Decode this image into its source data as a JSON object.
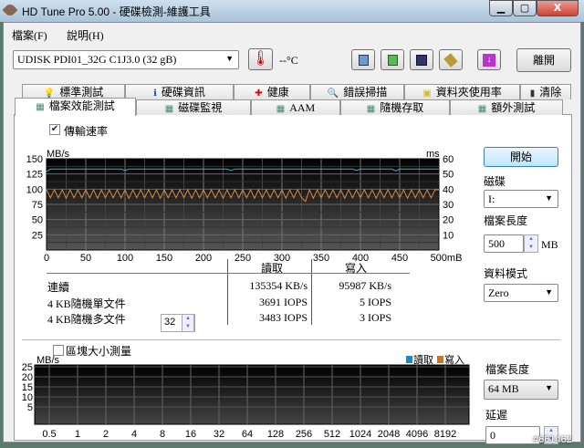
{
  "window": {
    "title": "HD Tune Pro  5.00 - 硬碟檢測-維護工具",
    "minimize": "▁",
    "maximize": "▢",
    "close": "X"
  },
  "menu": [
    "檔案(F)",
    "說明(H)"
  ],
  "toolbar": {
    "drive": "UDISK   PDI01_32G C1J3.0 (32 gB)",
    "temperature": "--°C",
    "exit": "離開"
  },
  "tabs_row1": [
    "標準測試",
    "硬碟資訊",
    "健康",
    "錯誤掃描",
    "資料夾使用率",
    "清除"
  ],
  "tabs_row2": [
    "檔案效能測試",
    "磁碟監視",
    "AAM",
    "隨機存取",
    "額外測試"
  ],
  "transfer": {
    "checkbox_label": "傳輸速率",
    "checked": true
  },
  "results": {
    "headers": [
      "讀取",
      "寫入"
    ],
    "rows": [
      {
        "label": "連續",
        "read": "135354 KB/s",
        "write": "95987 KB/s"
      },
      {
        "label": "4 KB隨機單文件",
        "read": "3691 IOPS",
        "write": "5 IOPS"
      },
      {
        "label": "4 KB隨機多文件",
        "read": "3483 IOPS",
        "write": "3 IOPS",
        "queue": "32"
      }
    ]
  },
  "right": {
    "start": "開始",
    "disk_label": "磁碟",
    "disk": "I:",
    "file_length_label": "檔案長度",
    "file_length": "500",
    "unit": "MB",
    "pattern_label": "資料模式",
    "pattern": "Zero"
  },
  "block": {
    "checkbox_label": "區塊大小測量",
    "checked": false,
    "file_length_label": "檔案長度",
    "file_length": "64 MB",
    "delay_label": "延遲",
    "delay": "0"
  },
  "watermark": "#661462",
  "chart_data": [
    {
      "type": "line",
      "ylabel": "MB/s",
      "y2label": "ms",
      "xunit": "mB",
      "xlim": [
        0,
        500
      ],
      "ylim": [
        0,
        150
      ],
      "y2lim": [
        0,
        60
      ],
      "xticks": [
        "0",
        "50",
        "100",
        "150",
        "200",
        "250",
        "300",
        "350",
        "400",
        "450",
        "500mB"
      ],
      "yticks": [
        "150",
        "125",
        "100",
        "75",
        "50",
        "25"
      ],
      "y2ticks": [
        "60",
        "50",
        "40",
        "30",
        "20",
        "10"
      ],
      "series": [
        {
          "name": "讀取",
          "color": "#4aa3c8",
          "step": 5,
          "values": [
            129,
            133,
            133,
            133,
            133,
            133,
            133,
            133,
            133,
            133,
            133,
            133,
            133,
            133,
            133,
            133,
            133,
            133,
            133,
            133,
            131,
            133,
            133,
            133,
            133,
            133,
            133,
            133,
            133,
            133,
            133,
            133,
            133,
            133,
            133,
            133,
            133,
            133,
            133,
            133,
            133,
            133,
            133,
            133,
            133,
            133,
            133,
            131,
            133,
            133,
            133,
            133,
            133,
            133,
            133,
            133,
            133,
            133,
            133,
            133,
            133,
            133,
            133,
            133,
            133,
            133,
            133,
            133,
            133,
            133,
            133,
            133,
            133,
            133,
            133,
            133,
            133,
            133,
            133,
            131,
            133,
            133,
            133,
            133,
            133,
            133,
            133,
            133,
            133,
            130,
            133,
            133,
            133,
            133,
            133,
            133,
            133,
            133,
            133,
            133,
            133
          ]
        },
        {
          "name": "寫入",
          "color": "#e0873a",
          "step": 5,
          "values": [
            99,
            86,
            99,
            86,
            99,
            85,
            99,
            86,
            99,
            86,
            99,
            86,
            99,
            85,
            99,
            86,
            99,
            86,
            99,
            86,
            99,
            85,
            99,
            86,
            99,
            86,
            99,
            86,
            99,
            85,
            99,
            86,
            99,
            86,
            99,
            86,
            99,
            85,
            99,
            86,
            99,
            86,
            99,
            86,
            99,
            85,
            99,
            86,
            99,
            86,
            99,
            86,
            99,
            85,
            99,
            86,
            99,
            86,
            99,
            86,
            99,
            85,
            99,
            86,
            99,
            86,
            80,
            99,
            85,
            99,
            86,
            99,
            86,
            99,
            86,
            99,
            85,
            99,
            86,
            99,
            86,
            99,
            86,
            99,
            85,
            99,
            86,
            99,
            86,
            99,
            86,
            99,
            85,
            99,
            86,
            99,
            86,
            99,
            86,
            99,
            99
          ]
        }
      ]
    },
    {
      "type": "bar",
      "ylabel": "MB/s",
      "ylim": [
        0,
        25
      ],
      "yticks": [
        "25",
        "20",
        "15",
        "10",
        "5"
      ],
      "categories": [
        "0.5",
        "1",
        "2",
        "4",
        "8",
        "16",
        "32",
        "64",
        "128",
        "256",
        "512",
        "1024",
        "2048",
        "4096",
        "8192"
      ],
      "legend": [
        "讀取",
        "寫入"
      ],
      "legend_colors": [
        "#1a8ac0",
        "#d07020"
      ],
      "series": []
    }
  ]
}
